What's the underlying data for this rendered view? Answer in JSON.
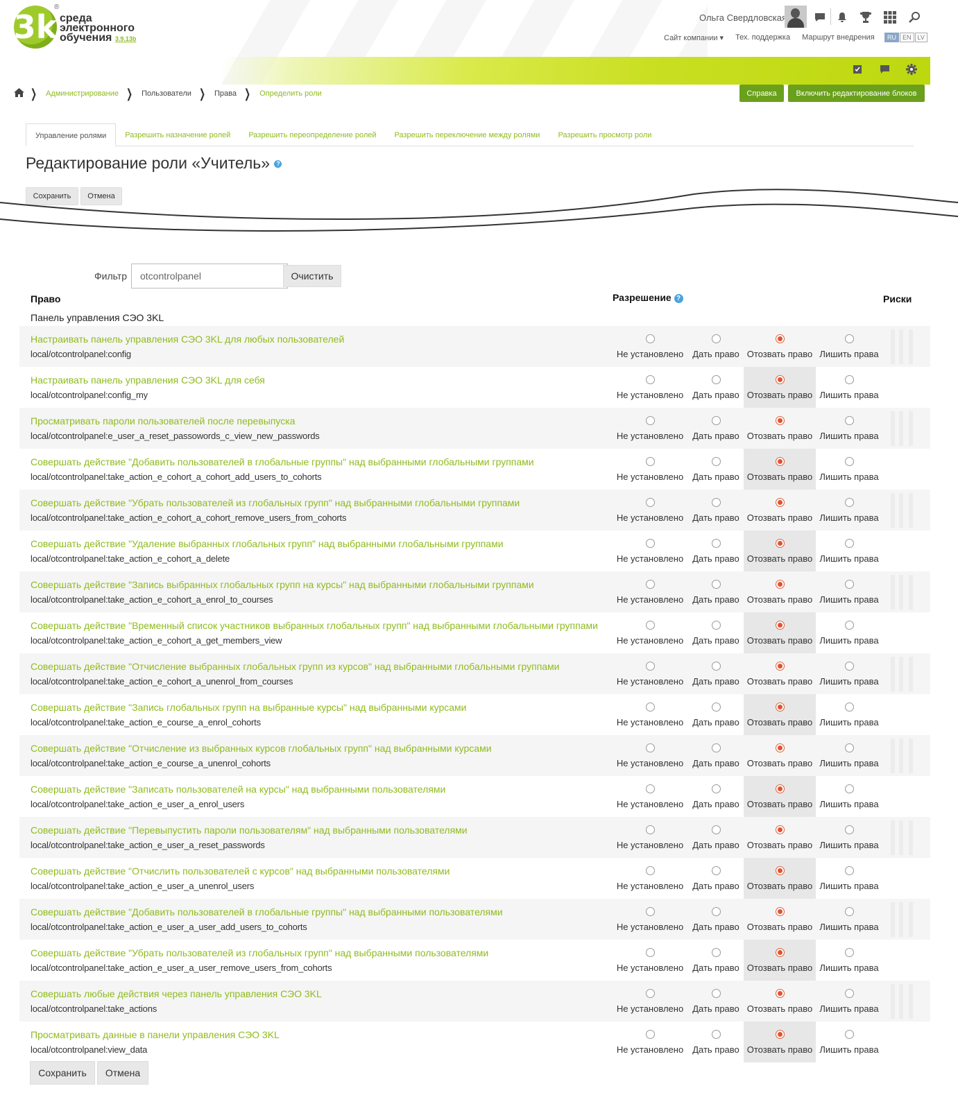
{
  "header": {
    "logo_text_1": "среда",
    "logo_text_2": "электронного",
    "logo_text_3": "обучения",
    "logo_version": "3.9.13b",
    "logo_mark": "3k",
    "user_name": "Ольга Свердловская",
    "links": [
      "Сайт компании ▾",
      "Тех. поддержка",
      "Маршрут внедрения"
    ],
    "languages": [
      "RU",
      "EN",
      "LV"
    ]
  },
  "breadcrumb": [
    {
      "label": "Администрирование",
      "link": true
    },
    {
      "label": "Пользователи",
      "link": false
    },
    {
      "label": "Права",
      "link": false
    },
    {
      "label": "Определить роли",
      "link": true
    }
  ],
  "actions": {
    "help": "Справка",
    "edit_blocks": "Включить редактирование блоков"
  },
  "tabs": [
    "Управление ролями",
    "Разрешить назначение ролей",
    "Разрешить переопределение ролей",
    "Разрешить переключение между ролями",
    "Разрешить просмотр роли"
  ],
  "page_title": "Редактирование роли «Учитель»",
  "buttons": {
    "save": "Сохранить",
    "cancel": "Отмена"
  },
  "filter": {
    "label": "Фильтр",
    "value": "otcontrolpanel",
    "clear": "Очистить"
  },
  "columns": {
    "capability": "Право",
    "permission": "Разрешение",
    "risks": "Риски"
  },
  "section": "Панель управления СЭО 3KL",
  "permission_labels": [
    "Не установлено",
    "Дать право",
    "Отозвать право",
    "Лишить права"
  ],
  "capabilities": [
    {
      "name": "Настраивать панель управления СЭО 3KL для любых пользователей",
      "id": "local/otcontrolpanel:config",
      "selected": 2
    },
    {
      "name": "Настраивать панель управления СЭО 3KL для себя",
      "id": "local/otcontrolpanel:config_my",
      "selected": 2
    },
    {
      "name": "Просматривать пароли пользователей после перевыпуска",
      "id": "local/otcontrolpanel:e_user_a_reset_passowords_c_view_new_passwords",
      "selected": 2
    },
    {
      "name": "Совершать действие \"Добавить пользователей в глобальные группы\" над выбранными глобальными группами",
      "id": "local/otcontrolpanel:take_action_e_cohort_a_cohort_add_users_to_cohorts",
      "selected": 2
    },
    {
      "name": "Совершать действие \"Убрать пользователей из глобальных групп\" над выбранными глобальными группами",
      "id": "local/otcontrolpanel:take_action_e_cohort_a_cohort_remove_users_from_cohorts",
      "selected": 2
    },
    {
      "name": "Совершать действие \"Удаление выбранных глобальных групп\" над выбранными глобальными группами",
      "id": "local/otcontrolpanel:take_action_e_cohort_a_delete",
      "selected": 2
    },
    {
      "name": "Совершать действие \"Запись выбранных глобальных групп на курсы\" над выбранными глобальными группами",
      "id": "local/otcontrolpanel:take_action_e_cohort_a_enrol_to_courses",
      "selected": 2
    },
    {
      "name": "Совершать действие \"Временный список участников выбранных глобальных групп\" над выбранными глобальными группами",
      "id": "local/otcontrolpanel:take_action_e_cohort_a_get_members_view",
      "selected": 2
    },
    {
      "name": "Совершать действие \"Отчисление выбранных глобальных групп из курсов\" над выбранными глобальными группами",
      "id": "local/otcontrolpanel:take_action_e_cohort_a_unenrol_from_courses",
      "selected": 2
    },
    {
      "name": "Совершать действие \"Запись глобальных групп на выбранные курсы\" над выбранными курсами",
      "id": "local/otcontrolpanel:take_action_e_course_a_enrol_cohorts",
      "selected": 2
    },
    {
      "name": "Совершать действие \"Отчисление из выбранных курсов глобальных групп\" над выбранными курсами",
      "id": "local/otcontrolpanel:take_action_e_course_a_unenrol_cohorts",
      "selected": 2
    },
    {
      "name": "Совершать действие \"Записать пользователей на курсы\" над выбранными пользователями",
      "id": "local/otcontrolpanel:take_action_e_user_a_enrol_users",
      "selected": 2
    },
    {
      "name": "Совершать действие \"Перевыпустить пароли пользователям\" над выбранными пользователями",
      "id": "local/otcontrolpanel:take_action_e_user_a_reset_passwords",
      "selected": 2
    },
    {
      "name": "Совершать действие \"Отчислить пользователей с курсов\" над выбранными пользователями",
      "id": "local/otcontrolpanel:take_action_e_user_a_unenrol_users",
      "selected": 2
    },
    {
      "name": "Совершать действие \"Добавить пользователей в глобальные группы\" над выбранными пользователями",
      "id": "local/otcontrolpanel:take_action_e_user_a_user_add_users_to_cohorts",
      "selected": 2
    },
    {
      "name": "Совершать действие \"Убрать пользователей из глобальных групп\" над выбранными пользователями",
      "id": "local/otcontrolpanel:take_action_e_user_a_user_remove_users_from_cohorts",
      "selected": 2
    },
    {
      "name": "Совершать любые действия через панель управления СЭО 3KL",
      "id": "local/otcontrolpanel:take_actions",
      "selected": 2
    },
    {
      "name": "Просматривать данные в панели управления СЭО 3KL",
      "id": "local/otcontrolpanel:view_data",
      "selected": 2
    }
  ]
}
